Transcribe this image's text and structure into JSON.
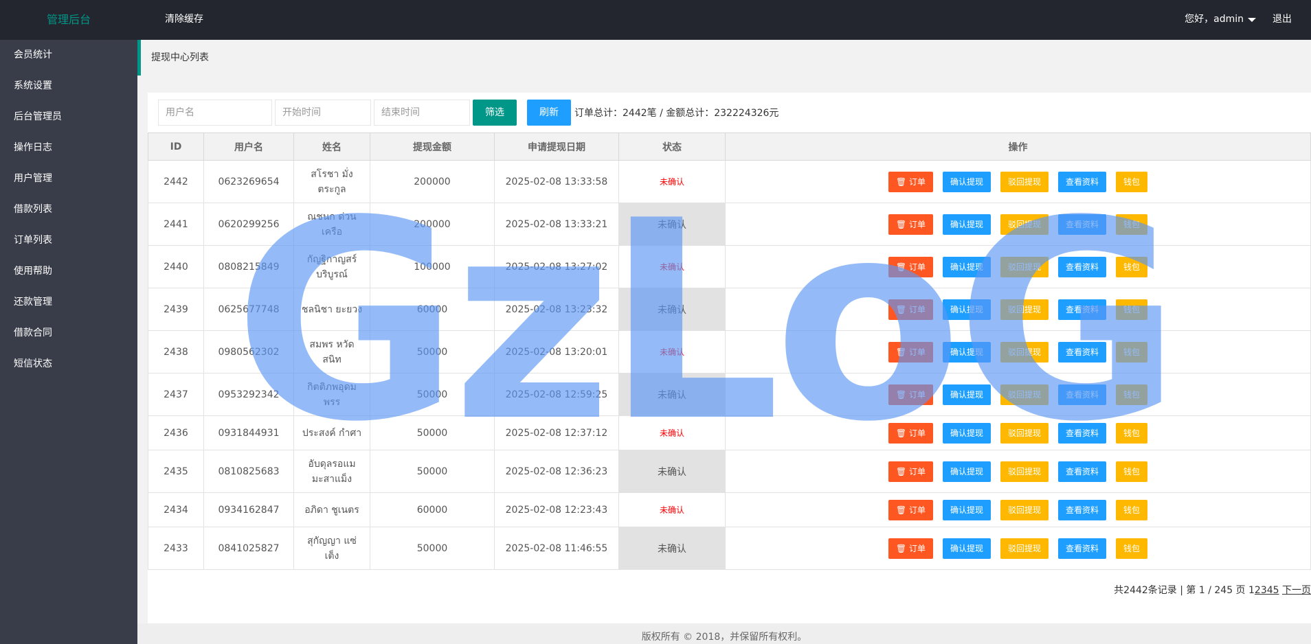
{
  "header": {
    "logo": "管理后台",
    "clear_cache": "清除缓存",
    "greeting": "您好，admin",
    "logout": "退出"
  },
  "sidebar": {
    "items": [
      {
        "label": "会员统计"
      },
      {
        "label": "系统设置"
      },
      {
        "label": "后台管理员"
      },
      {
        "label": "操作日志"
      },
      {
        "label": "用户管理"
      },
      {
        "label": "借款列表"
      },
      {
        "label": "订单列表"
      },
      {
        "label": "使用帮助"
      },
      {
        "label": "还款管理"
      },
      {
        "label": "借款合同"
      },
      {
        "label": "短信状态"
      }
    ]
  },
  "breadcrumb": "提现中心列表",
  "filter": {
    "username_placeholder": "用户名",
    "start_placeholder": "开始时间",
    "end_placeholder": "结束时间",
    "filter_button": "筛选",
    "refresh_button": "刷新",
    "summary": "订单总计：2442笔 / 金额总计：232224326元"
  },
  "table": {
    "headers": [
      "ID",
      "用户名",
      "姓名",
      "提现金额",
      "申请提现日期",
      "状态",
      "操作"
    ],
    "rows": [
      {
        "id": "2442",
        "username": "0623269654",
        "name": "สโรชา มั่งตระกูล",
        "amount": "200000",
        "date": "2025-02-08 13:33:58",
        "status": "未确认",
        "confirmed": false
      },
      {
        "id": "2441",
        "username": "0620299256",
        "name": "ณชนก ด่วนเครือ",
        "amount": "200000",
        "date": "2025-02-08 13:33:21",
        "status": "未确认",
        "confirmed": true
      },
      {
        "id": "2440",
        "username": "0808215849",
        "name": "กัญฐิกาญสร์ บริบูรณ์",
        "amount": "100000",
        "date": "2025-02-08 13:27:02",
        "status": "未确认",
        "confirmed": false
      },
      {
        "id": "2439",
        "username": "0625677748",
        "name": "ชลนิชา ยะยวง",
        "amount": "60000",
        "date": "2025-02-08 13:23:32",
        "status": "未确认",
        "confirmed": true
      },
      {
        "id": "2438",
        "username": "0980562302",
        "name": "สมพร หวัดสนิท",
        "amount": "50000",
        "date": "2025-02-08 13:20:01",
        "status": "未确认",
        "confirmed": false
      },
      {
        "id": "2437",
        "username": "0953292342",
        "name": "กิตติภพอุดมพรร",
        "amount": "50000",
        "date": "2025-02-08 12:59:25",
        "status": "未确认",
        "confirmed": true
      },
      {
        "id": "2436",
        "username": "0931844931",
        "name": "ประสงค์ กำศา",
        "amount": "50000",
        "date": "2025-02-08 12:37:12",
        "status": "未确认",
        "confirmed": false
      },
      {
        "id": "2435",
        "username": "0810825683",
        "name": "อับดุลรอแม มะสาแม็ง",
        "amount": "50000",
        "date": "2025-02-08 12:36:23",
        "status": "未确认",
        "confirmed": true
      },
      {
        "id": "2434",
        "username": "0934162847",
        "name": "อภิดา ชูเนตร",
        "amount": "60000",
        "date": "2025-02-08 12:23:43",
        "status": "未确认",
        "confirmed": false
      },
      {
        "id": "2433",
        "username": "0841025827",
        "name": "สุกัญญา แซ่เต็ง",
        "amount": "50000",
        "date": "2025-02-08 11:46:55",
        "status": "未确认",
        "confirmed": true
      }
    ],
    "actions": {
      "order": "订单",
      "confirm": "确认提现",
      "reject": "驳回提现",
      "profile": "查看资料",
      "wallet": "钱包"
    }
  },
  "pagination": {
    "info": "共2442条记录 | 第 1 / 245 页 1",
    "pages": "2345",
    "next": "下一页"
  },
  "footer": "版权所有 © 2018，并保留所有权利。",
  "watermark": "GzLoG",
  "colors": {
    "header_bg": "#23262e",
    "sidebar_bg": "#393d49",
    "accent_green": "#009688",
    "btn_blue": "#1e9fff",
    "btn_red": "#ff5722",
    "btn_yellow": "#ffb800"
  }
}
